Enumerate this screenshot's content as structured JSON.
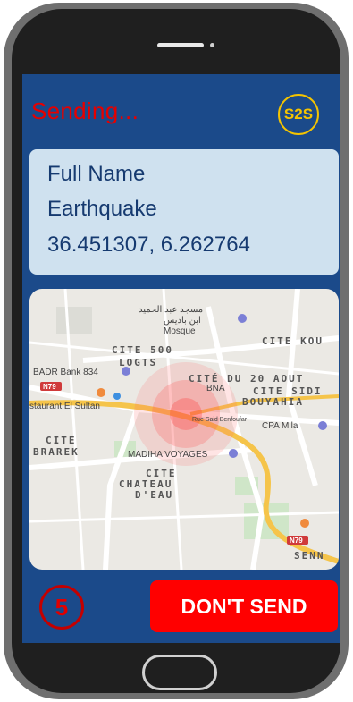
{
  "app": {
    "status_text": "Sending...",
    "logo_text": "S2S"
  },
  "info": {
    "name": "Full Name",
    "event": "Earthquake",
    "coordinates": "36.451307, 6.262764"
  },
  "map": {
    "labels": {
      "mosque_ar": "مسجد عبد الحميد",
      "mosque_ar2": "ابن باديس",
      "mosque": "Mosque",
      "cite500": "CITE 500",
      "logts": "LOGTS",
      "citeKou": "CITE KOU",
      "badr": "BADR Bank 834",
      "n79a": "N79",
      "citeDu20": "CITÉ DU 20 AOUT",
      "bna": "BNA",
      "citeSidi": "CITE SIDI",
      "bouyahia": "BOUYAHIA",
      "restaurant": "staurant El Sultan",
      "rueSaid": "Rue Said Benfoufar",
      "cpa": "CPA Mila",
      "cite1": "CITE",
      "brarek": "BRAREK",
      "madiha": "MADIHA VOYAGES",
      "cite2": "CITE",
      "chateau": "CHATEAU",
      "deau": "D'EAU",
      "n79b": "N79",
      "senn": "SENN"
    }
  },
  "countdown": {
    "value": "5"
  },
  "actions": {
    "dont_send_label": "DON'T SEND"
  },
  "colors": {
    "screen_bg": "#1b4a8a",
    "accent_red": "#ff0000",
    "logo_yellow": "#f5c400"
  }
}
